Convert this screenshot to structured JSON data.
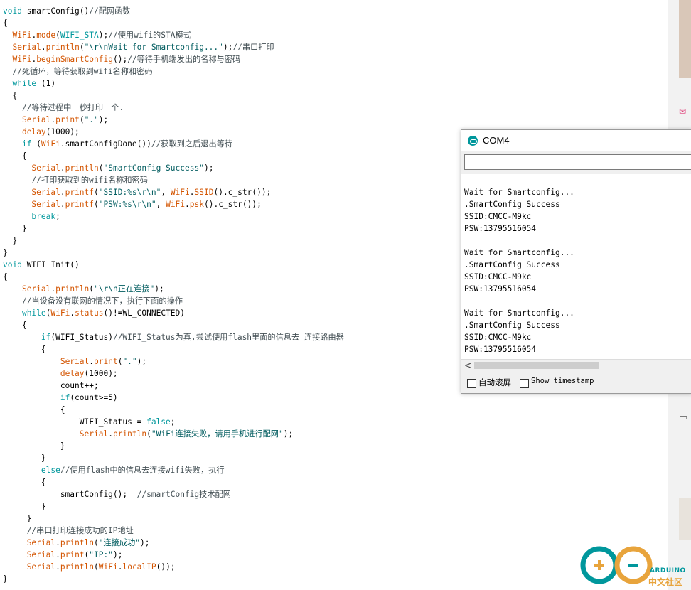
{
  "code_lines": [
    {
      "t": [
        {
          "c": "kw",
          "s": "void"
        },
        {
          "c": "",
          "s": " smartConfig()"
        },
        {
          "c": "ct",
          "s": "//配网函数"
        }
      ]
    },
    {
      "t": [
        {
          "c": "",
          "s": "{"
        }
      ]
    },
    {
      "t": [
        {
          "c": "",
          "s": "  "
        },
        {
          "c": "fn",
          "s": "WiFi"
        },
        {
          "c": "",
          "s": "."
        },
        {
          "c": "fn",
          "s": "mode"
        },
        {
          "c": "",
          "s": "("
        },
        {
          "c": "cn",
          "s": "WIFI_STA"
        },
        {
          "c": "",
          "s": ");"
        },
        {
          "c": "ct",
          "s": "//使用wifi的STA模式"
        }
      ]
    },
    {
      "t": [
        {
          "c": "",
          "s": "  "
        },
        {
          "c": "fn",
          "s": "Serial"
        },
        {
          "c": "",
          "s": "."
        },
        {
          "c": "fn",
          "s": "println"
        },
        {
          "c": "",
          "s": "("
        },
        {
          "c": "st",
          "s": "\"\\r\\nWait for Smartconfig...\""
        },
        {
          "c": "",
          "s": ");"
        },
        {
          "c": "ct",
          "s": "//串口打印"
        }
      ]
    },
    {
      "t": [
        {
          "c": "",
          "s": "  "
        },
        {
          "c": "fn",
          "s": "WiFi"
        },
        {
          "c": "",
          "s": "."
        },
        {
          "c": "fn",
          "s": "beginSmartConfig"
        },
        {
          "c": "",
          "s": "();"
        },
        {
          "c": "ct",
          "s": "//等待手机端发出的名称与密码"
        }
      ]
    },
    {
      "t": [
        {
          "c": "",
          "s": "  "
        },
        {
          "c": "ct",
          "s": "//死循环，等待获取到wifi名称和密码"
        }
      ]
    },
    {
      "t": [
        {
          "c": "",
          "s": "  "
        },
        {
          "c": "kw",
          "s": "while"
        },
        {
          "c": "",
          "s": " (1)"
        }
      ]
    },
    {
      "t": [
        {
          "c": "",
          "s": "  {"
        }
      ]
    },
    {
      "t": [
        {
          "c": "",
          "s": "    "
        },
        {
          "c": "ct",
          "s": "//等待过程中一秒打印一个."
        }
      ]
    },
    {
      "t": [
        {
          "c": "",
          "s": "    "
        },
        {
          "c": "fn",
          "s": "Serial"
        },
        {
          "c": "",
          "s": "."
        },
        {
          "c": "fn",
          "s": "print"
        },
        {
          "c": "",
          "s": "("
        },
        {
          "c": "st",
          "s": "\".\""
        },
        {
          "c": "",
          "s": ");"
        }
      ]
    },
    {
      "t": [
        {
          "c": "",
          "s": "    "
        },
        {
          "c": "fn",
          "s": "delay"
        },
        {
          "c": "",
          "s": "(1000);"
        }
      ]
    },
    {
      "t": [
        {
          "c": "",
          "s": "    "
        },
        {
          "c": "kw",
          "s": "if"
        },
        {
          "c": "",
          "s": " ("
        },
        {
          "c": "fn",
          "s": "WiFi"
        },
        {
          "c": "",
          "s": ".smartConfigDone())"
        },
        {
          "c": "ct",
          "s": "//获取到之后退出等待"
        }
      ]
    },
    {
      "t": [
        {
          "c": "",
          "s": "    {"
        }
      ]
    },
    {
      "t": [
        {
          "c": "",
          "s": "      "
        },
        {
          "c": "fn",
          "s": "Serial"
        },
        {
          "c": "",
          "s": "."
        },
        {
          "c": "fn",
          "s": "println"
        },
        {
          "c": "",
          "s": "("
        },
        {
          "c": "st",
          "s": "\"SmartConfig Success\""
        },
        {
          "c": "",
          "s": ");"
        }
      ]
    },
    {
      "t": [
        {
          "c": "",
          "s": "      "
        },
        {
          "c": "ct",
          "s": "//打印获取到的wifi名称和密码"
        }
      ]
    },
    {
      "t": [
        {
          "c": "",
          "s": "      "
        },
        {
          "c": "fn",
          "s": "Serial"
        },
        {
          "c": "",
          "s": "."
        },
        {
          "c": "fn",
          "s": "printf"
        },
        {
          "c": "",
          "s": "("
        },
        {
          "c": "st",
          "s": "\"SSID:%s\\r\\n\""
        },
        {
          "c": "",
          "s": ", "
        },
        {
          "c": "fn",
          "s": "WiFi"
        },
        {
          "c": "",
          "s": "."
        },
        {
          "c": "fn",
          "s": "SSID"
        },
        {
          "c": "",
          "s": "().c_str());"
        }
      ]
    },
    {
      "t": [
        {
          "c": "",
          "s": "      "
        },
        {
          "c": "fn",
          "s": "Serial"
        },
        {
          "c": "",
          "s": "."
        },
        {
          "c": "fn",
          "s": "printf"
        },
        {
          "c": "",
          "s": "("
        },
        {
          "c": "st",
          "s": "\"PSW:%s\\r\\n\""
        },
        {
          "c": "",
          "s": ", "
        },
        {
          "c": "fn",
          "s": "WiFi"
        },
        {
          "c": "",
          "s": "."
        },
        {
          "c": "fn",
          "s": "psk"
        },
        {
          "c": "",
          "s": "().c_str());"
        }
      ]
    },
    {
      "t": [
        {
          "c": "",
          "s": "      "
        },
        {
          "c": "kw",
          "s": "break"
        },
        {
          "c": "",
          "s": ";"
        }
      ]
    },
    {
      "t": [
        {
          "c": "",
          "s": "    }"
        }
      ]
    },
    {
      "t": [
        {
          "c": "",
          "s": "  }"
        }
      ]
    },
    {
      "t": [
        {
          "c": "",
          "s": "}"
        }
      ]
    },
    {
      "t": [
        {
          "c": "kw",
          "s": "void"
        },
        {
          "c": "",
          "s": " WIFI_Init()"
        }
      ]
    },
    {
      "t": [
        {
          "c": "",
          "s": "{"
        }
      ]
    },
    {
      "t": [
        {
          "c": "",
          "s": "    "
        },
        {
          "c": "fn",
          "s": "Serial"
        },
        {
          "c": "",
          "s": "."
        },
        {
          "c": "fn",
          "s": "println"
        },
        {
          "c": "",
          "s": "("
        },
        {
          "c": "st",
          "s": "\"\\r\\n正在连接\""
        },
        {
          "c": "",
          "s": ");"
        }
      ]
    },
    {
      "t": [
        {
          "c": "",
          "s": "    "
        },
        {
          "c": "ct",
          "s": "//当设备没有联网的情况下，执行下面的操作"
        }
      ]
    },
    {
      "t": [
        {
          "c": "",
          "s": "    "
        },
        {
          "c": "kw",
          "s": "while"
        },
        {
          "c": "",
          "s": "("
        },
        {
          "c": "fn",
          "s": "WiFi"
        },
        {
          "c": "",
          "s": "."
        },
        {
          "c": "fn",
          "s": "status"
        },
        {
          "c": "",
          "s": "()!=WL_CONNECTED)"
        }
      ]
    },
    {
      "t": [
        {
          "c": "",
          "s": "    {"
        }
      ]
    },
    {
      "t": [
        {
          "c": "",
          "s": "        "
        },
        {
          "c": "kw",
          "s": "if"
        },
        {
          "c": "",
          "s": "(WIFI_Status)"
        },
        {
          "c": "ct",
          "s": "//WIFI_Status为真,尝试使用flash里面的信息去 连接路由器"
        }
      ]
    },
    {
      "t": [
        {
          "c": "",
          "s": "        {"
        }
      ]
    },
    {
      "t": [
        {
          "c": "",
          "s": "            "
        },
        {
          "c": "fn",
          "s": "Serial"
        },
        {
          "c": "",
          "s": "."
        },
        {
          "c": "fn",
          "s": "print"
        },
        {
          "c": "",
          "s": "("
        },
        {
          "c": "st",
          "s": "\".\""
        },
        {
          "c": "",
          "s": ");"
        }
      ]
    },
    {
      "t": [
        {
          "c": "",
          "s": "            "
        },
        {
          "c": "fn",
          "s": "delay"
        },
        {
          "c": "",
          "s": "(1000);"
        }
      ]
    },
    {
      "t": [
        {
          "c": "",
          "s": "            count++;"
        }
      ]
    },
    {
      "t": [
        {
          "c": "",
          "s": "            "
        },
        {
          "c": "kw",
          "s": "if"
        },
        {
          "c": "",
          "s": "(count>=5)"
        }
      ]
    },
    {
      "t": [
        {
          "c": "",
          "s": "            {"
        }
      ]
    },
    {
      "t": [
        {
          "c": "",
          "s": "                WIFI_Status = "
        },
        {
          "c": "cn",
          "s": "false"
        },
        {
          "c": "",
          "s": ";"
        }
      ]
    },
    {
      "t": [
        {
          "c": "",
          "s": "                "
        },
        {
          "c": "fn",
          "s": "Serial"
        },
        {
          "c": "",
          "s": "."
        },
        {
          "c": "fn",
          "s": "println"
        },
        {
          "c": "",
          "s": "("
        },
        {
          "c": "st",
          "s": "\"WiFi连接失败，请用手机进行配网\""
        },
        {
          "c": "",
          "s": ");"
        }
      ]
    },
    {
      "t": [
        {
          "c": "",
          "s": "            }"
        }
      ]
    },
    {
      "t": [
        {
          "c": "",
          "s": "        }"
        }
      ]
    },
    {
      "t": [
        {
          "c": "",
          "s": "        "
        },
        {
          "c": "kw",
          "s": "else"
        },
        {
          "c": "ct",
          "s": "//使用flash中的信息去连接wifi失败，执行"
        }
      ]
    },
    {
      "t": [
        {
          "c": "",
          "s": "        {"
        }
      ]
    },
    {
      "t": [
        {
          "c": "",
          "s": "            smartConfig();  "
        },
        {
          "c": "ct",
          "s": "//smartConfig技术配网"
        }
      ]
    },
    {
      "t": [
        {
          "c": "",
          "s": "        }"
        }
      ]
    },
    {
      "t": [
        {
          "c": "",
          "s": "     }"
        }
      ]
    },
    {
      "t": [
        {
          "c": "",
          "s": "     "
        },
        {
          "c": "ct",
          "s": "//串口打印连接成功的IP地址"
        }
      ]
    },
    {
      "t": [
        {
          "c": "",
          "s": "     "
        },
        {
          "c": "fn",
          "s": "Serial"
        },
        {
          "c": "",
          "s": "."
        },
        {
          "c": "fn",
          "s": "println"
        },
        {
          "c": "",
          "s": "("
        },
        {
          "c": "st",
          "s": "\"连接成功\""
        },
        {
          "c": "",
          "s": ");"
        }
      ]
    },
    {
      "t": [
        {
          "c": "",
          "s": "     "
        },
        {
          "c": "fn",
          "s": "Serial"
        },
        {
          "c": "",
          "s": "."
        },
        {
          "c": "fn",
          "s": "print"
        },
        {
          "c": "",
          "s": "("
        },
        {
          "c": "st",
          "s": "\"IP:\""
        },
        {
          "c": "",
          "s": ");"
        }
      ]
    },
    {
      "t": [
        {
          "c": "",
          "s": "     "
        },
        {
          "c": "fn",
          "s": "Serial"
        },
        {
          "c": "",
          "s": "."
        },
        {
          "c": "fn",
          "s": "println"
        },
        {
          "c": "",
          "s": "("
        },
        {
          "c": "fn",
          "s": "WiFi"
        },
        {
          "c": "",
          "s": "."
        },
        {
          "c": "fn",
          "s": "localIP"
        },
        {
          "c": "",
          "s": "());"
        }
      ]
    },
    {
      "t": [
        {
          "c": "",
          "s": "}"
        }
      ]
    }
  ],
  "serial_monitor": {
    "title": "COM4",
    "input_value": "",
    "output_lines": [
      "",
      "Wait for Smartconfig...",
      ".SmartConfig Success",
      "SSID:CMCC-M9kc",
      "PSW:13795516054",
      "",
      "Wait for Smartconfig...",
      ".SmartConfig Success",
      "SSID:CMCC-M9kc",
      "PSW:13795516054",
      "",
      "Wait for Smartconfig...",
      ".SmartConfig Success",
      "SSID:CMCC-M9kc",
      "PSW:13795516054"
    ],
    "scroll_left_arrow": "<",
    "autoscroll_label": "自动滚屏",
    "autoscroll_checked": false,
    "timestamp_label": "Show timestamp",
    "timestamp_checked": false
  },
  "logo": {
    "name": "ARDUINO",
    "subtitle": "中文社区",
    "colors": {
      "teal": "#00979c",
      "orange": "#e8a43c"
    }
  },
  "colors": {
    "keyword": "#00979c",
    "function": "#d35400",
    "comment": "#434f54",
    "string": "#005c5f"
  }
}
